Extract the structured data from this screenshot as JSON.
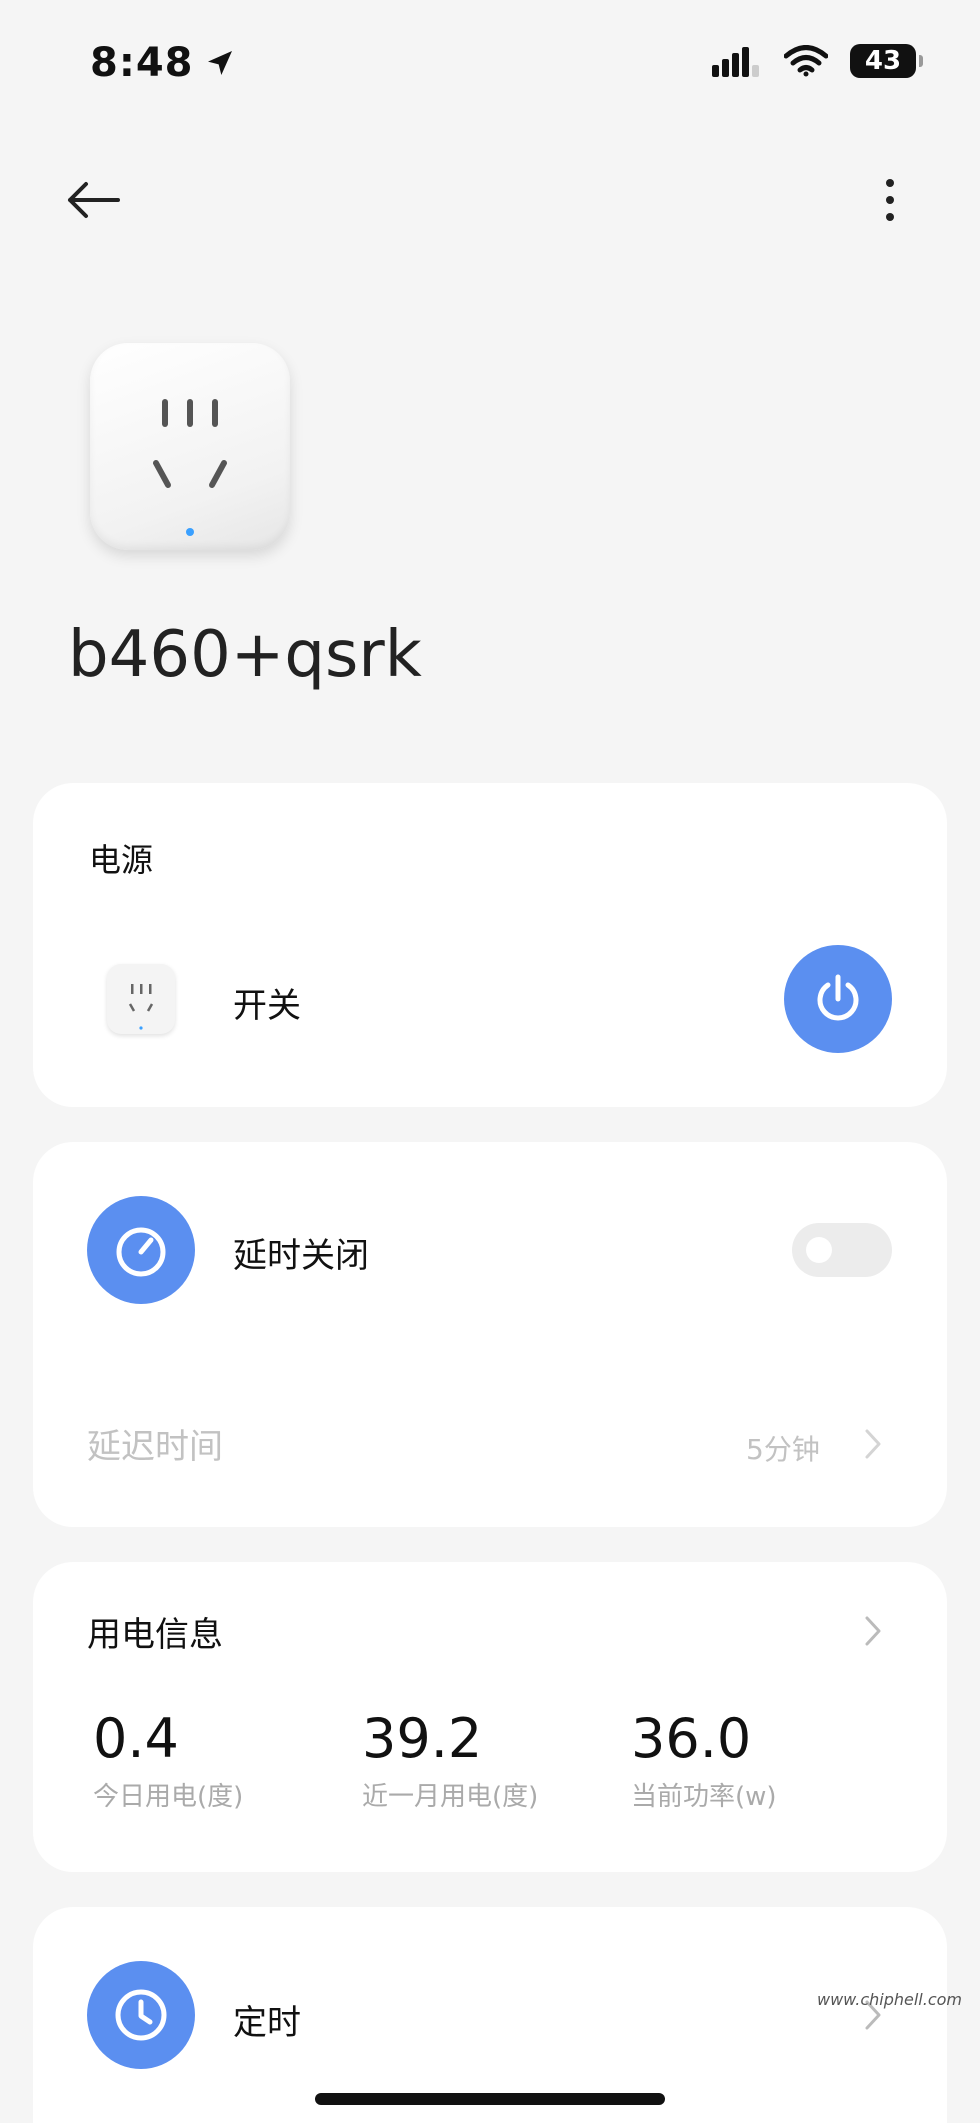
{
  "status_bar": {
    "time": "8:48",
    "battery": "43",
    "icons": [
      "location-arrow-icon",
      "signal-icon",
      "wifi-icon",
      "battery-icon"
    ]
  },
  "nav": {
    "back_icon": "back-arrow-icon",
    "more_icon": "more-vertical-icon"
  },
  "device": {
    "name": "b460+qsrk"
  },
  "power_card": {
    "title": "电源",
    "switch_label": "开关",
    "power_state": "on",
    "accent": "#5b8ff0"
  },
  "delay_card": {
    "title": "延时关闭",
    "toggle_on": false,
    "delay_label": "延迟时间",
    "delay_value": "5分钟"
  },
  "power_info_card": {
    "title": "用电信息",
    "stats": [
      {
        "value": "0.4",
        "label": "今日用电(度)"
      },
      {
        "value": "39.2",
        "label": "近一月用电(度)"
      },
      {
        "value": "36.0",
        "label": "当前功率(w)"
      }
    ]
  },
  "timer_card": {
    "title": "定时"
  },
  "watermark": "www.chiphell.com"
}
